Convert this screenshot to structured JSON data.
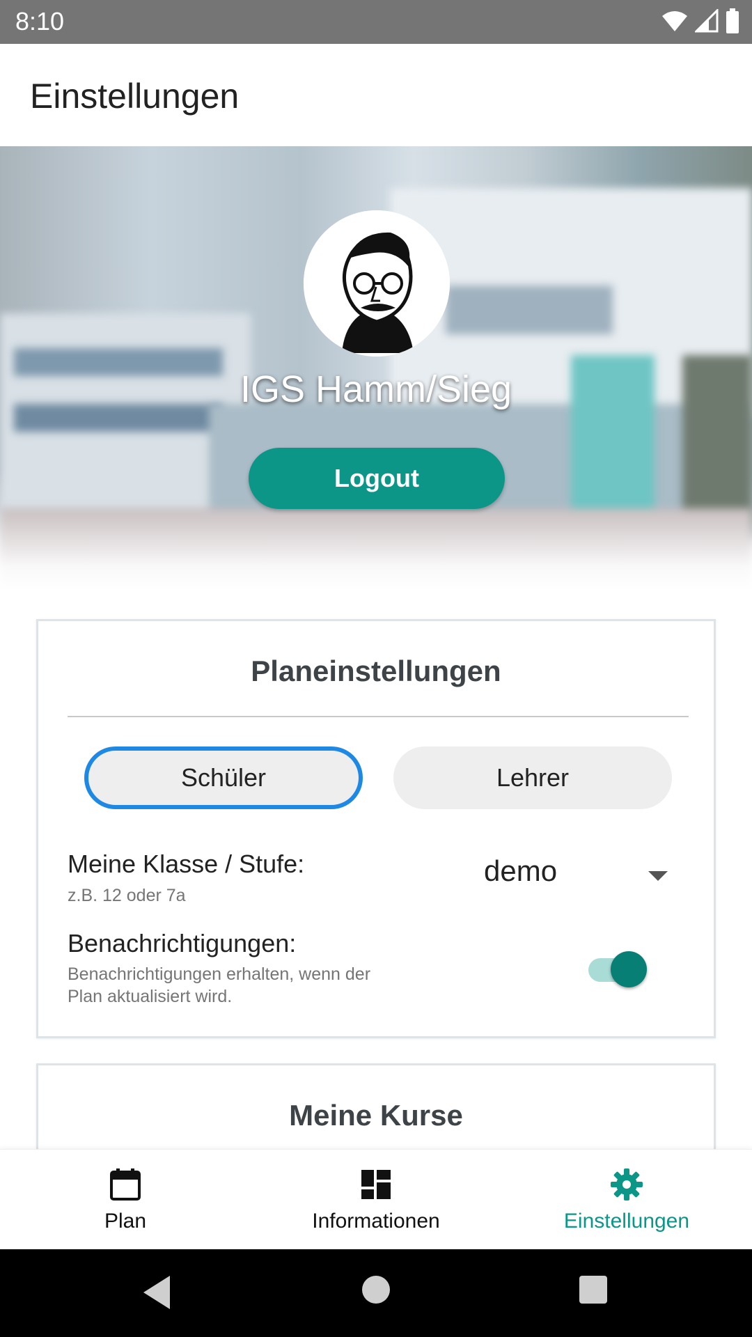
{
  "status_bar": {
    "time": "8:10",
    "icons": [
      "wifi-icon",
      "signal-icon",
      "battery-icon"
    ]
  },
  "app_bar": {
    "title": "Einstellungen"
  },
  "hero": {
    "school_name": "IGS Hamm/Sieg",
    "logout_label": "Logout"
  },
  "plan_settings": {
    "title": "Planeinstellungen",
    "role_options": [
      "Schüler",
      "Lehrer"
    ],
    "selected_role": "Schüler",
    "class_label": "Meine Klasse / Stufe:",
    "class_hint": "z.B. 12 oder 7a",
    "class_value": "demo",
    "notifications_label": "Benachrichtigungen:",
    "notifications_hint": "Benachrichtigungen erhalten, wenn der Plan aktualisiert wird.",
    "notifications_enabled": true
  },
  "courses": {
    "title": "Meine Kurse"
  },
  "bottom_nav": {
    "items": [
      {
        "label": "Plan",
        "icon": "calendar-icon"
      },
      {
        "label": "Informationen",
        "icon": "dashboard-icon"
      },
      {
        "label": "Einstellungen",
        "icon": "gear-icon"
      }
    ],
    "active": "Einstellungen"
  },
  "system_nav": {
    "icons": [
      "back-icon",
      "home-icon",
      "recents-icon"
    ]
  },
  "colors": {
    "accent": "#0b9688",
    "selected_outline": "#1e88e5",
    "status_bar": "#757575"
  }
}
